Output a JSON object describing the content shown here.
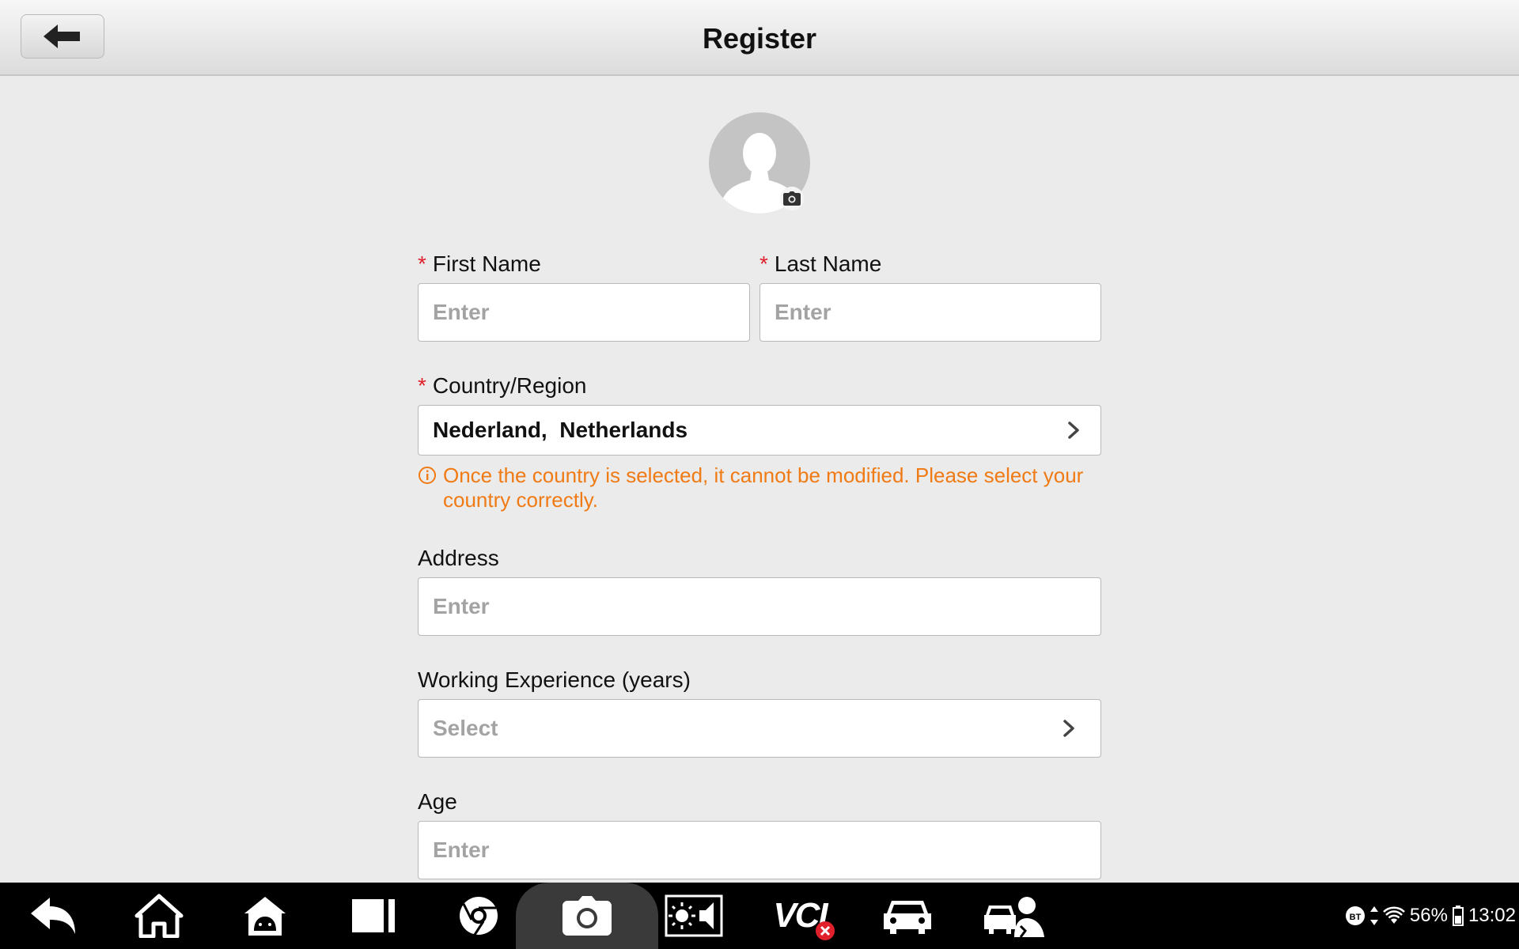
{
  "header": {
    "title": "Register"
  },
  "form": {
    "first_name": {
      "label": "First Name",
      "placeholder": "Enter"
    },
    "last_name": {
      "label": "Last Name",
      "placeholder": "Enter"
    },
    "country": {
      "label": "Country/Region",
      "value": "Nederland,  Netherlands"
    },
    "country_warning": "Once the country is selected, it cannot be modified. Please select your country correctly.",
    "address": {
      "label": "Address",
      "placeholder": "Enter"
    },
    "experience": {
      "label": "Working Experience (years)",
      "placeholder": "Select"
    },
    "age": {
      "label": "Age",
      "placeholder": "Enter"
    },
    "required_mark": "*"
  },
  "navbar": {
    "vci_label": "VCI",
    "battery": "56%",
    "time": "13:02",
    "bt_label": "BT"
  },
  "colors": {
    "warning": "#f07a14",
    "required": "#e0202a"
  }
}
